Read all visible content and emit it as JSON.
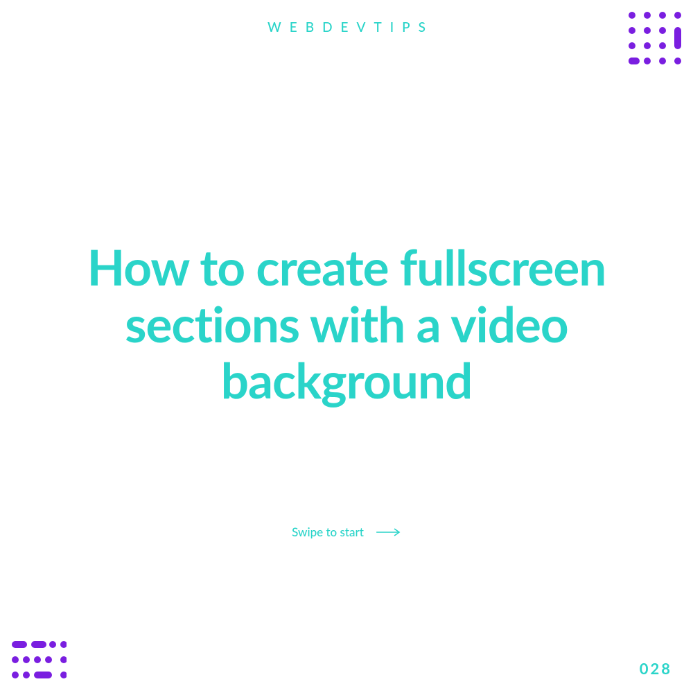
{
  "colors": {
    "accent": "#2AD4C9",
    "decoration": "#7A1EE0",
    "background": "#FFFFFF"
  },
  "brand": "WEBDEVTIPS",
  "title": "How to create fullscreen sections with a video background",
  "swipe_label": "Swipe to start",
  "page_number": "028"
}
